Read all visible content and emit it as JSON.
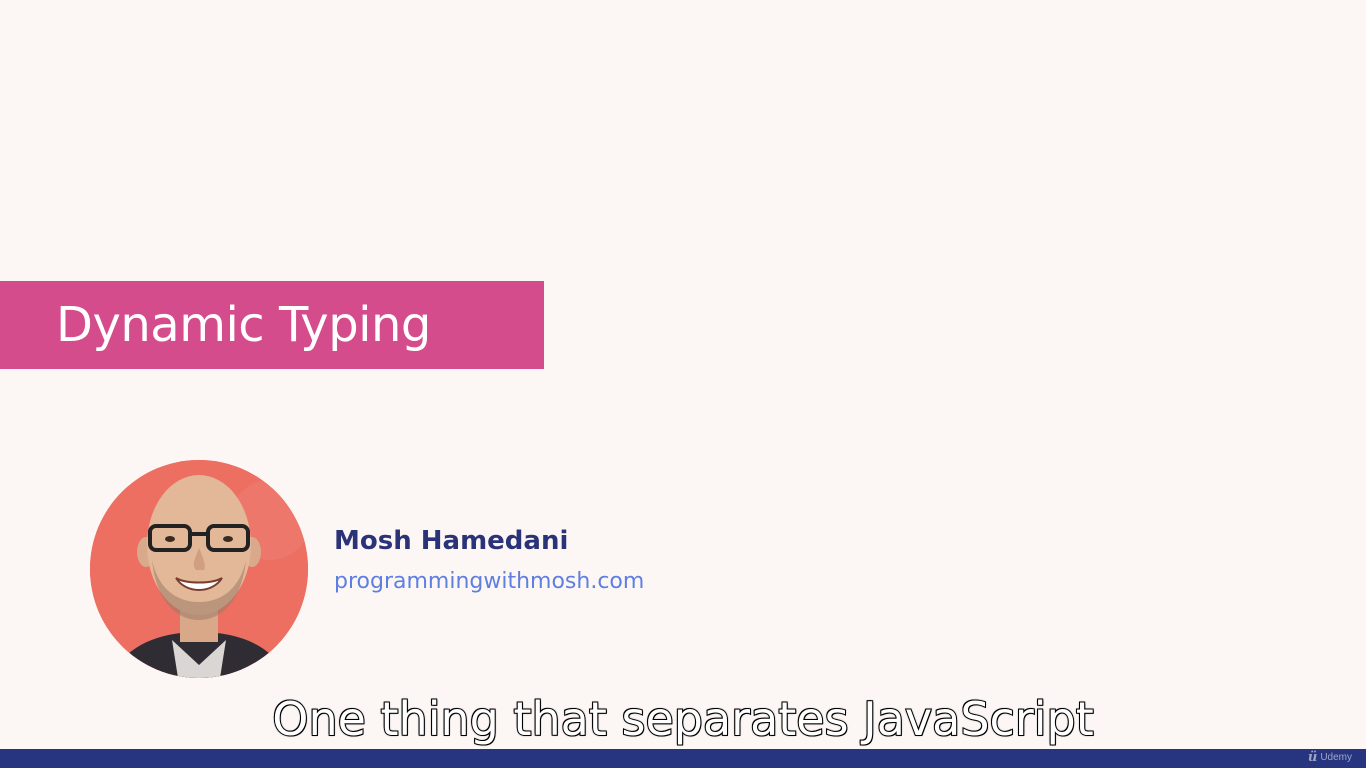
{
  "slide": {
    "title": "Dynamic Typing",
    "presenter_name": "Mosh Hamedani",
    "presenter_website": "programmingwithmosh.com"
  },
  "caption": {
    "text": "One thing that separates JavaScript"
  },
  "watermark": {
    "brand": "Udemy",
    "icon": "udemy-logo-icon"
  },
  "colors": {
    "background": "#fcf7f5",
    "title_banner": "#d44c8c",
    "presenter_name": "#2a3377",
    "presenter_website": "#5f7fe0",
    "avatar_background": "#ec6f62",
    "bottom_bar": "#27347f"
  }
}
